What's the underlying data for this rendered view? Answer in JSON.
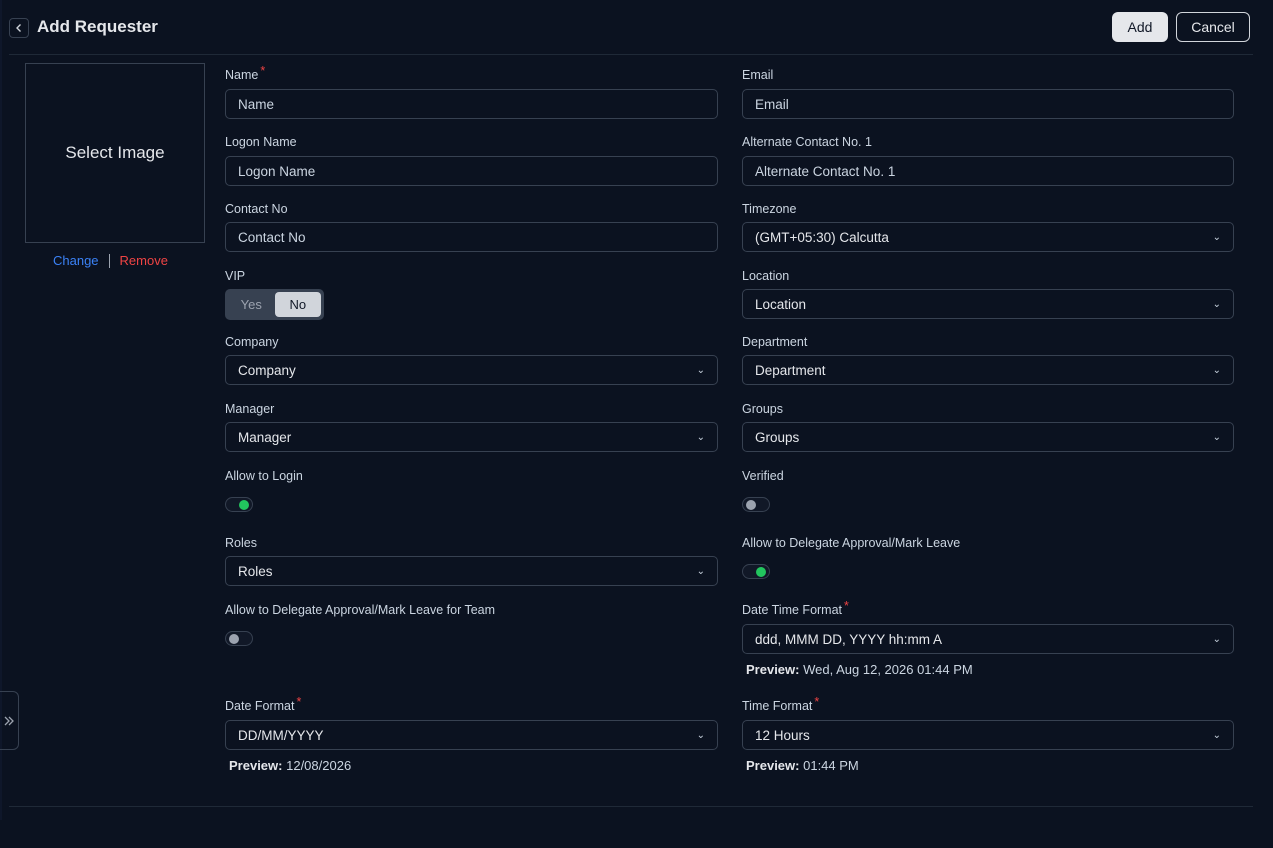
{
  "header": {
    "title": "Add Requester",
    "add_label": "Add",
    "cancel_label": "Cancel"
  },
  "image": {
    "select_label": "Select Image",
    "change_label": "Change",
    "remove_label": "Remove"
  },
  "fields": {
    "name": {
      "label": "Name",
      "placeholder": "Name"
    },
    "email": {
      "label": "Email",
      "placeholder": "Email"
    },
    "logon": {
      "label": "Logon Name",
      "placeholder": "Logon Name"
    },
    "alt_contact": {
      "label": "Alternate Contact No. 1",
      "placeholder": "Alternate Contact No. 1"
    },
    "contact": {
      "label": "Contact No",
      "placeholder": "Contact No"
    },
    "timezone": {
      "label": "Timezone",
      "value": "(GMT+05:30) Calcutta"
    },
    "vip": {
      "label": "VIP",
      "yes": "Yes",
      "no": "No",
      "selected": "No"
    },
    "location": {
      "label": "Location",
      "value": "Location"
    },
    "company": {
      "label": "Company",
      "value": "Company"
    },
    "department": {
      "label": "Department",
      "value": "Department"
    },
    "manager": {
      "label": "Manager",
      "value": "Manager"
    },
    "groups": {
      "label": "Groups",
      "value": "Groups"
    },
    "allow_login": {
      "label": "Allow to Login",
      "on": true
    },
    "verified": {
      "label": "Verified",
      "on": false
    },
    "roles": {
      "label": "Roles",
      "value": "Roles"
    },
    "delegate": {
      "label": "Allow to Delegate Approval/Mark Leave",
      "on": true
    },
    "delegate_team": {
      "label": "Allow to Delegate Approval/Mark Leave for Team",
      "on": false
    },
    "datetime_format": {
      "label": "Date Time Format",
      "value": "ddd, MMM DD, YYYY hh:mm A",
      "preview_label": "Preview:",
      "preview": "Wed, Aug 12, 2026 01:44 PM"
    },
    "date_format": {
      "label": "Date Format",
      "value": "DD/MM/YYYY",
      "preview_label": "Preview:",
      "preview": "12/08/2026"
    },
    "time_format": {
      "label": "Time Format",
      "value": "12 Hours",
      "preview_label": "Preview:",
      "preview": "01:44 PM"
    }
  },
  "colors": {
    "background": "#0b1220",
    "accent_green": "#22c55e",
    "link_blue": "#3b82f6",
    "danger_red": "#ef4444"
  },
  "icons": {
    "back": "chevron-left-icon",
    "dropdown": "chevron-down-icon",
    "sidebar_expand": "double-chevron-right-icon"
  }
}
